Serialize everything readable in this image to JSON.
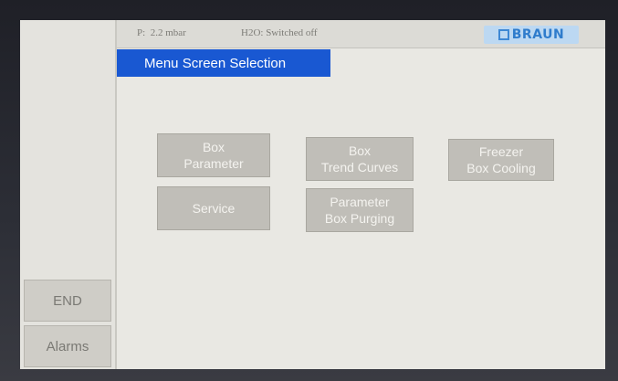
{
  "status_bar": {
    "pressure_label": "P:",
    "pressure_value": "2.2 mbar",
    "h2o_status": "H2O: Switched off"
  },
  "brand": {
    "logo_text": "BRAUN"
  },
  "title": "Menu Screen Selection",
  "menu_buttons": [
    {
      "line1": "Box",
      "line2": "Parameter"
    },
    {
      "line1": "Box",
      "line2": "Trend Curves"
    },
    {
      "line1": "Freezer",
      "line2": "Box Cooling"
    },
    {
      "line1": "Service",
      "line2": ""
    },
    {
      "line1": "Parameter",
      "line2": "Box Purging"
    }
  ],
  "sidebar": {
    "end_label": "END",
    "alarms_label": "Alarms"
  },
  "colors": {
    "title_banner": "#1958d2",
    "logo_background": "#bcd8f2",
    "logo_text": "#2f7ccc",
    "button_face": "#c0beb8",
    "screen_background": "#e9e8e3"
  }
}
